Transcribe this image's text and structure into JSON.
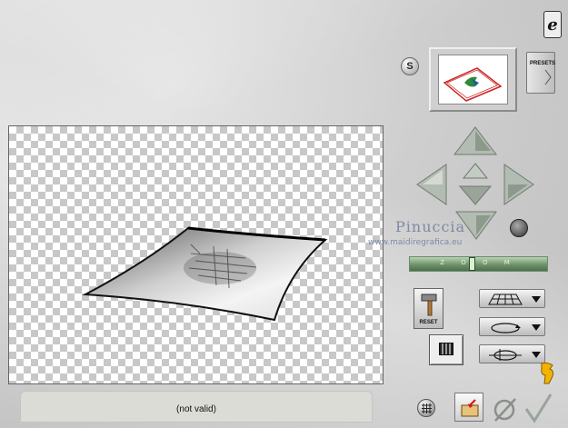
{
  "header": {
    "signature_glyph": "e",
    "s_label": "S",
    "presets_label": "PRESETS"
  },
  "watermark": {
    "name": "Pinuccia",
    "url": "www.maidiregrafica.eu"
  },
  "zoom": {
    "label": "Z O O M",
    "level": 0.45
  },
  "buttons": {
    "reset_label": "RESET"
  },
  "status": {
    "text": "(not valid)"
  },
  "colors": {
    "arrow": "#a9b3a8",
    "slider_green": "#6f926b",
    "watermark": "#7d8aa5",
    "hand_yellow": "#f2b300"
  },
  "icons": {
    "sig": "signature-icon",
    "grid": "grid-icon",
    "folder": "folder-arrow-icon",
    "cancel": "cancel-icon",
    "ok": "checkmark-icon",
    "hand": "pointing-hand-icon",
    "mode1": "perspective-grid-icon",
    "mode2": "rotate-ellipse-icon",
    "mode3": "rotate-axis-icon"
  }
}
